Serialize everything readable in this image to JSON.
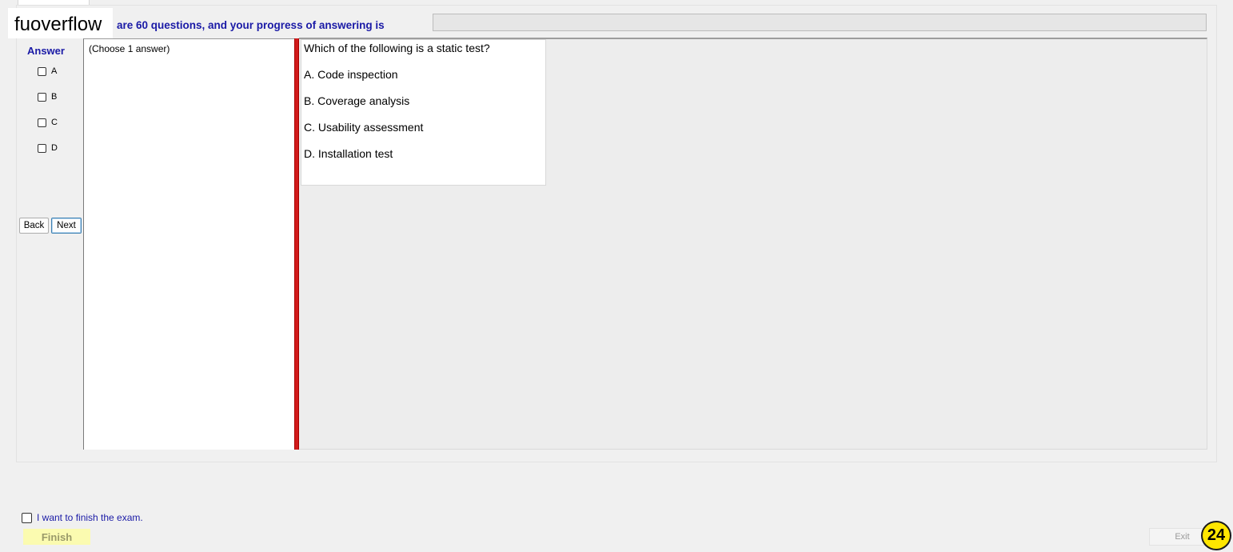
{
  "watermark": "fuoverflow",
  "header": {
    "progress_text": "are 60 questions, and your progress of answering is",
    "progress_value": 0,
    "progress_fill_color": "#06b025"
  },
  "answer_panel": {
    "title": "Answer",
    "options": [
      "A",
      "B",
      "C",
      "D"
    ],
    "back_label": "Back",
    "next_label": "Next"
  },
  "answer_pane": {
    "hint": "(Choose 1 answer)"
  },
  "question": {
    "text": "Which of the following is a static test?",
    "options": [
      "A.  Code inspection",
      "B.  Coverage analysis",
      "C.  Usability assessment",
      "D.  Installation test"
    ]
  },
  "footer": {
    "finish_checkbox_label": "I want to finish the exam.",
    "finish_label": "Finish",
    "exit_label": "Exit",
    "page_number": "24"
  }
}
